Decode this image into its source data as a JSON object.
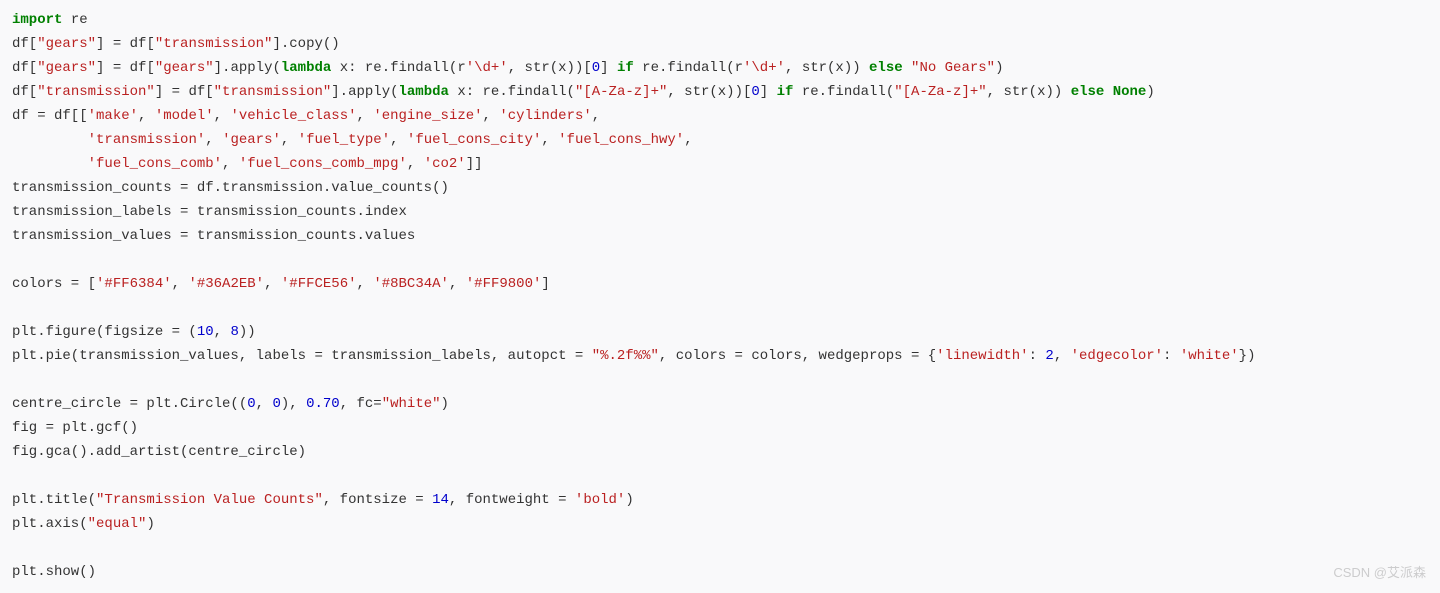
{
  "code": {
    "l1": {
      "a": "import",
      "b": " re"
    },
    "l2": {
      "a": "df[",
      "b": "\"gears\"",
      "c": "] = df[",
      "d": "\"transmission\"",
      "e": "].copy()"
    },
    "l3": {
      "a": "df[",
      "b": "\"gears\"",
      "c": "] = df[",
      "d": "\"gears\"",
      "e": "].apply(",
      "f": "lambda",
      "g": " x: re.findall(r",
      "h": "'\\d+'",
      "i": ", str(x))[",
      "j": "0",
      "k": "] ",
      "l": "if",
      "m": " re.findall(r",
      "n": "'\\d+'",
      "o": ", str(x)) ",
      "p": "else",
      "q": " ",
      "r": "\"No Gears\"",
      "s": ")"
    },
    "l4": {
      "a": "df[",
      "b": "\"transmission\"",
      "c": "] = df[",
      "d": "\"transmission\"",
      "e": "].apply(",
      "f": "lambda",
      "g": " x: re.findall(",
      "h": "\"[A-Za-z]+\"",
      "i": ", str(x))[",
      "j": "0",
      "k": "] ",
      "l": "if",
      "m": " re.findall(",
      "n": "\"[A-Za-z]+\"",
      "o": ", str(x)) ",
      "p": "else",
      "q": " ",
      "r": "None",
      "s": ")"
    },
    "l5": {
      "a": "df = df[[",
      "b": "'make'",
      "c": ", ",
      "d": "'model'",
      "e": ", ",
      "f": "'vehicle_class'",
      "g": ", ",
      "h": "'engine_size'",
      "i": ", ",
      "j": "'cylinders'",
      "k": ","
    },
    "l6": {
      "a": "         ",
      "b": "'transmission'",
      "c": ", ",
      "d": "'gears'",
      "e": ", ",
      "f": "'fuel_type'",
      "g": ", ",
      "h": "'fuel_cons_city'",
      "i": ", ",
      "j": "'fuel_cons_hwy'",
      "k": ","
    },
    "l7": {
      "a": "         ",
      "b": "'fuel_cons_comb'",
      "c": ", ",
      "d": "'fuel_cons_comb_mpg'",
      "e": ", ",
      "f": "'co2'",
      "g": "]]"
    },
    "l8": {
      "a": "transmission_counts = df.transmission.value_counts()"
    },
    "l9": {
      "a": "transmission_labels = transmission_counts.index"
    },
    "l10": {
      "a": "transmission_values = transmission_counts.values"
    },
    "l11": {},
    "l12": {
      "a": "colors = [",
      "b": "'#FF6384'",
      "c": ", ",
      "d": "'#36A2EB'",
      "e": ", ",
      "f": "'#FFCE56'",
      "g": ", ",
      "h": "'#8BC34A'",
      "i": ", ",
      "j": "'#FF9800'",
      "k": "]"
    },
    "l13": {},
    "l14": {
      "a": "plt.figure(figsize = (",
      "b": "10",
      "c": ", ",
      "d": "8",
      "e": "))"
    },
    "l15": {
      "a": "plt.pie(transmission_values, labels = transmission_labels, autopct = ",
      "b": "\"%.2f%%\"",
      "c": ", colors = colors, wedgeprops = {",
      "d": "'linewidth'",
      "e": ": ",
      "f": "2",
      "g": ", ",
      "h": "'edgecolor'",
      "i": ": ",
      "j": "'white'",
      "k": "})"
    },
    "l16": {},
    "l17": {
      "a": "centre_circle = plt.Circle((",
      "b": "0",
      "c": ", ",
      "d": "0",
      "e": "), ",
      "f": "0.70",
      "g": ", fc=",
      "h": "\"white\"",
      "i": ")"
    },
    "l18": {
      "a": "fig = plt.gcf()"
    },
    "l19": {
      "a": "fig.gca().add_artist(centre_circle)"
    },
    "l20": {},
    "l21": {
      "a": "plt.title(",
      "b": "\"Transmission Value Counts\"",
      "c": ", fontsize = ",
      "d": "14",
      "e": ", fontweight = ",
      "f": "'bold'",
      "g": ")"
    },
    "l22": {
      "a": "plt.axis(",
      "b": "\"equal\"",
      "c": ")"
    },
    "l23": {},
    "l24": {
      "a": "plt.show()"
    }
  },
  "watermark": "CSDN @艾派森"
}
